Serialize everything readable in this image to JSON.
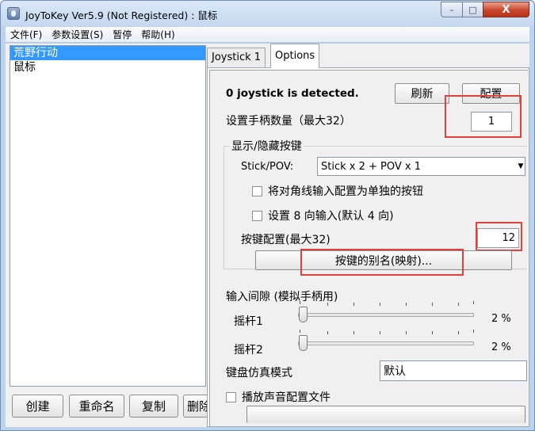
{
  "window": {
    "title": "JoyToKey Ver5.9 (Not Registered) : 鼠标",
    "min_glyph": "–",
    "max_glyph": "□",
    "close_glyph": "X"
  },
  "menu": [
    "文件(F)",
    "参数设置(S)",
    "暂停",
    "帮助(H)"
  ],
  "profiles": [
    {
      "label": "荒野行动",
      "selected": true
    },
    {
      "label": "鼠标",
      "selected": false
    }
  ],
  "profile_buttons": [
    "创建",
    "重命名",
    "复制",
    "删除"
  ],
  "tabs": [
    {
      "label": "Joystick 1",
      "active": false
    },
    {
      "label": "Options",
      "active": true
    }
  ],
  "options": {
    "detect_status": "0 joystick is detected.",
    "refresh_button": "刷新",
    "config_button": "配置",
    "joystick_count_label": "设置手柄数量（最大32）",
    "joystick_count_value": "1",
    "show_hide_group": "显示/隐藏按键",
    "stick_pov_label": "Stick/POV:",
    "stick_pov_value": "Stick x 2 + POV x 1",
    "combo_arrow": "▼",
    "diagonal_checkbox": "将对角线输入配置为单独的按钮",
    "diagonal_checked": false,
    "eight_way_checkbox": "设置 8 向输入(默认 4 向)",
    "eight_way_checked": false,
    "button_config_label": "按键配置(最大32)",
    "button_config_value": "12",
    "alias_button": "按键的别名(映射)...",
    "input_gap_label": "输入间隙 (模拟手柄用)",
    "stick1_label": "摇杆1",
    "stick1_value": "2 %",
    "stick1_level_percent": 2,
    "stick2_label": "摇杆2",
    "stick2_value": "2 %",
    "stick2_level_percent": 2,
    "keyboard_mode_label": "键盘仿真模式",
    "keyboard_mode_value": "默认",
    "play_sound_checkbox": "播放声音配置文件",
    "play_sound_checked": false
  },
  "colors": {
    "selection": "#3399ff",
    "highlight_box": "#e2403b",
    "close_button": "#c9462c"
  }
}
